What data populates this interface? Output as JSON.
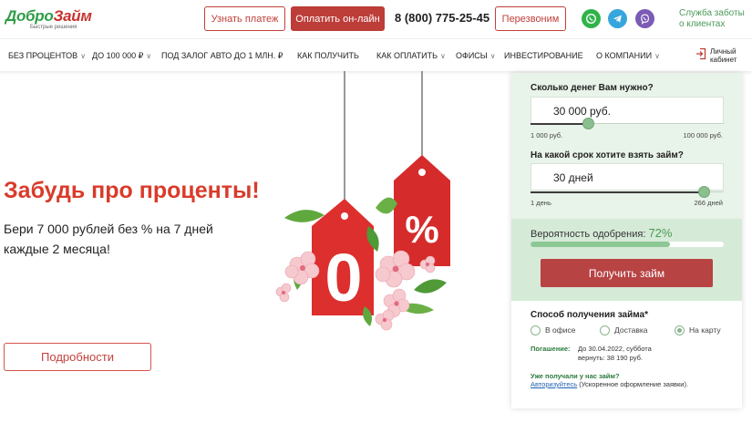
{
  "header": {
    "logo": {
      "part1": "Добро",
      "part2": "Займ",
      "tagline": "Быстрые решения"
    },
    "learn_payment": "Узнать платеж",
    "pay_online": "Оплатить он-лайн",
    "phone": "8 (800) 775-25-45",
    "callback": "Перезвоним",
    "support_line1": "Служба заботы",
    "support_line2": "о клиентах",
    "social_icons": [
      "whatsapp-icon",
      "telegram-icon",
      "viber-icon"
    ]
  },
  "nav": {
    "items": [
      {
        "label": "БЕЗ ПРОЦЕНТОВ",
        "has_dropdown": true
      },
      {
        "label": "ДО 100 000 ₽",
        "has_dropdown": true
      },
      {
        "label": "ПОД ЗАЛОГ АВТО ДО 1 МЛН. ₽",
        "has_dropdown": false
      },
      {
        "label": "КАК ПОЛУЧИТЬ",
        "has_dropdown": false
      },
      {
        "label": "КАК ОПЛАТИТЬ",
        "has_dropdown": true
      },
      {
        "label": "ОФИСЫ",
        "has_dropdown": true
      },
      {
        "label": "ИНВЕСТИРОВАНИЕ",
        "has_dropdown": false
      },
      {
        "label": "О КОМПАНИИ",
        "has_dropdown": true
      }
    ],
    "cabinet_line1": "Личный",
    "cabinet_line2": "кабинет"
  },
  "hero": {
    "title": "Забудь про проценты!",
    "text_line1": "Бери 7 000 рублей без % на 7 дней",
    "text_line2": "каждые 2 месяца!",
    "tag_zero": "0",
    "tag_percent": "%",
    "details_button": "Подробности"
  },
  "calculator": {
    "amount_question": "Сколько денег Вам нужно?",
    "amount_value": "30 000 руб.",
    "amount_min": "1 000 руб.",
    "amount_max": "100 000 руб.",
    "amount_fraction": 0.333,
    "term_question": "На какой срок хотите взять займ?",
    "term_value": "30 дней",
    "term_min": "1 день",
    "term_max": "266 дней",
    "term_fraction": 1.0,
    "approval_label": "Вероятность одобрения:",
    "approval_value": "72%",
    "approval_fraction": 0.72,
    "get_loan_button": "Получить займ",
    "method_title": "Способ получения займа*",
    "methods": [
      {
        "label": "В офисе",
        "selected": false
      },
      {
        "label": "Доставка",
        "selected": false
      },
      {
        "label": "На карту",
        "selected": true
      }
    ],
    "repay_key": "Погашение:",
    "repay_line1": "До 30.04.2022, суббота",
    "repay_line2": "вернуть: 38 190 руб.",
    "already_title": "Уже получали у нас займ?",
    "auth_link": "Авторизуйтесь",
    "auth_rest": " (Ускоренное оформление заявки)."
  },
  "colors": {
    "brand_red": "#bd3d38",
    "brand_green": "#2e9e45",
    "title_red": "#d93b2a",
    "calc_bg": "#e8f3e9",
    "knob_green": "#8bbf8e"
  }
}
